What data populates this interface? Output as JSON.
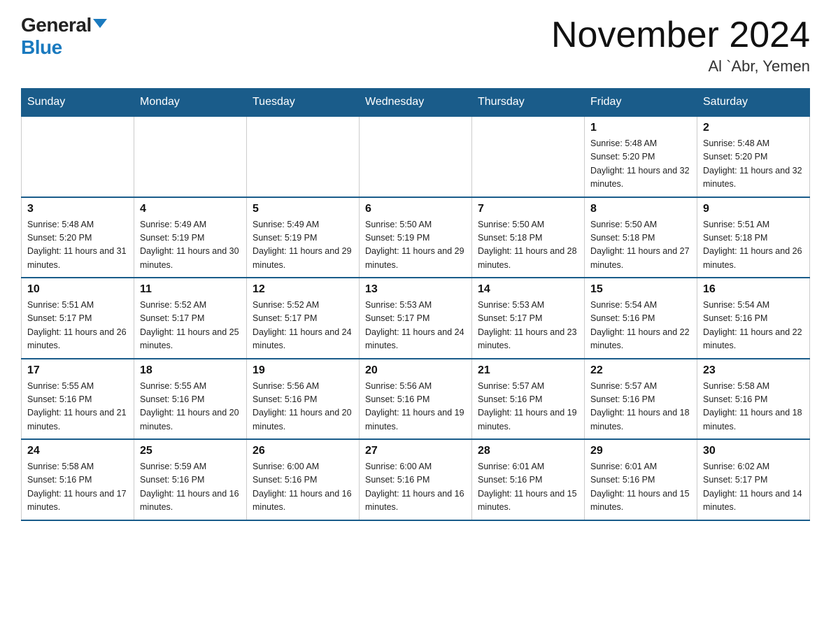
{
  "header": {
    "logo_general": "General",
    "logo_blue": "Blue",
    "month_title": "November 2024",
    "location": "Al `Abr, Yemen"
  },
  "days_of_week": [
    "Sunday",
    "Monday",
    "Tuesday",
    "Wednesday",
    "Thursday",
    "Friday",
    "Saturday"
  ],
  "weeks": [
    [
      {
        "day": "",
        "info": ""
      },
      {
        "day": "",
        "info": ""
      },
      {
        "day": "",
        "info": ""
      },
      {
        "day": "",
        "info": ""
      },
      {
        "day": "",
        "info": ""
      },
      {
        "day": "1",
        "info": "Sunrise: 5:48 AM\nSunset: 5:20 PM\nDaylight: 11 hours and 32 minutes."
      },
      {
        "day": "2",
        "info": "Sunrise: 5:48 AM\nSunset: 5:20 PM\nDaylight: 11 hours and 32 minutes."
      }
    ],
    [
      {
        "day": "3",
        "info": "Sunrise: 5:48 AM\nSunset: 5:20 PM\nDaylight: 11 hours and 31 minutes."
      },
      {
        "day": "4",
        "info": "Sunrise: 5:49 AM\nSunset: 5:19 PM\nDaylight: 11 hours and 30 minutes."
      },
      {
        "day": "5",
        "info": "Sunrise: 5:49 AM\nSunset: 5:19 PM\nDaylight: 11 hours and 29 minutes."
      },
      {
        "day": "6",
        "info": "Sunrise: 5:50 AM\nSunset: 5:19 PM\nDaylight: 11 hours and 29 minutes."
      },
      {
        "day": "7",
        "info": "Sunrise: 5:50 AM\nSunset: 5:18 PM\nDaylight: 11 hours and 28 minutes."
      },
      {
        "day": "8",
        "info": "Sunrise: 5:50 AM\nSunset: 5:18 PM\nDaylight: 11 hours and 27 minutes."
      },
      {
        "day": "9",
        "info": "Sunrise: 5:51 AM\nSunset: 5:18 PM\nDaylight: 11 hours and 26 minutes."
      }
    ],
    [
      {
        "day": "10",
        "info": "Sunrise: 5:51 AM\nSunset: 5:17 PM\nDaylight: 11 hours and 26 minutes."
      },
      {
        "day": "11",
        "info": "Sunrise: 5:52 AM\nSunset: 5:17 PM\nDaylight: 11 hours and 25 minutes."
      },
      {
        "day": "12",
        "info": "Sunrise: 5:52 AM\nSunset: 5:17 PM\nDaylight: 11 hours and 24 minutes."
      },
      {
        "day": "13",
        "info": "Sunrise: 5:53 AM\nSunset: 5:17 PM\nDaylight: 11 hours and 24 minutes."
      },
      {
        "day": "14",
        "info": "Sunrise: 5:53 AM\nSunset: 5:17 PM\nDaylight: 11 hours and 23 minutes."
      },
      {
        "day": "15",
        "info": "Sunrise: 5:54 AM\nSunset: 5:16 PM\nDaylight: 11 hours and 22 minutes."
      },
      {
        "day": "16",
        "info": "Sunrise: 5:54 AM\nSunset: 5:16 PM\nDaylight: 11 hours and 22 minutes."
      }
    ],
    [
      {
        "day": "17",
        "info": "Sunrise: 5:55 AM\nSunset: 5:16 PM\nDaylight: 11 hours and 21 minutes."
      },
      {
        "day": "18",
        "info": "Sunrise: 5:55 AM\nSunset: 5:16 PM\nDaylight: 11 hours and 20 minutes."
      },
      {
        "day": "19",
        "info": "Sunrise: 5:56 AM\nSunset: 5:16 PM\nDaylight: 11 hours and 20 minutes."
      },
      {
        "day": "20",
        "info": "Sunrise: 5:56 AM\nSunset: 5:16 PM\nDaylight: 11 hours and 19 minutes."
      },
      {
        "day": "21",
        "info": "Sunrise: 5:57 AM\nSunset: 5:16 PM\nDaylight: 11 hours and 19 minutes."
      },
      {
        "day": "22",
        "info": "Sunrise: 5:57 AM\nSunset: 5:16 PM\nDaylight: 11 hours and 18 minutes."
      },
      {
        "day": "23",
        "info": "Sunrise: 5:58 AM\nSunset: 5:16 PM\nDaylight: 11 hours and 18 minutes."
      }
    ],
    [
      {
        "day": "24",
        "info": "Sunrise: 5:58 AM\nSunset: 5:16 PM\nDaylight: 11 hours and 17 minutes."
      },
      {
        "day": "25",
        "info": "Sunrise: 5:59 AM\nSunset: 5:16 PM\nDaylight: 11 hours and 16 minutes."
      },
      {
        "day": "26",
        "info": "Sunrise: 6:00 AM\nSunset: 5:16 PM\nDaylight: 11 hours and 16 minutes."
      },
      {
        "day": "27",
        "info": "Sunrise: 6:00 AM\nSunset: 5:16 PM\nDaylight: 11 hours and 16 minutes."
      },
      {
        "day": "28",
        "info": "Sunrise: 6:01 AM\nSunset: 5:16 PM\nDaylight: 11 hours and 15 minutes."
      },
      {
        "day": "29",
        "info": "Sunrise: 6:01 AM\nSunset: 5:16 PM\nDaylight: 11 hours and 15 minutes."
      },
      {
        "day": "30",
        "info": "Sunrise: 6:02 AM\nSunset: 5:17 PM\nDaylight: 11 hours and 14 minutes."
      }
    ]
  ]
}
